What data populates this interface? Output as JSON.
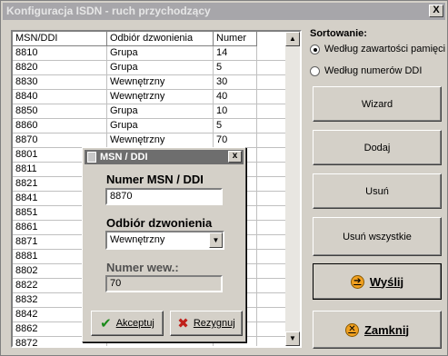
{
  "window": {
    "title": "Konfiguracja ISDN - ruch przychodzący",
    "close_label": "X"
  },
  "list": {
    "columns": [
      "MSN/DDI",
      "Odbiór dzwonienia",
      "Numer"
    ],
    "rows": [
      [
        "8810",
        "Grupa",
        "14"
      ],
      [
        "8820",
        "Grupa",
        "5"
      ],
      [
        "8830",
        "Wewnętrzny",
        "30"
      ],
      [
        "8840",
        "Wewnętrzny",
        "40"
      ],
      [
        "8850",
        "Grupa",
        "10"
      ],
      [
        "8860",
        "Grupa",
        "5"
      ],
      [
        "8870",
        "Wewnętrzny",
        "70"
      ],
      [
        "8801",
        "",
        ""
      ],
      [
        "8811",
        "",
        ""
      ],
      [
        "8821",
        "",
        ""
      ],
      [
        "8841",
        "",
        ""
      ],
      [
        "8851",
        "",
        ""
      ],
      [
        "8861",
        "",
        ""
      ],
      [
        "8871",
        "",
        ""
      ],
      [
        "8881",
        "",
        ""
      ],
      [
        "8802",
        "",
        ""
      ],
      [
        "8822",
        "",
        ""
      ],
      [
        "8832",
        "",
        ""
      ],
      [
        "8842",
        "",
        ""
      ],
      [
        "8862",
        "",
        ""
      ],
      [
        "8872",
        "",
        ""
      ]
    ]
  },
  "sorting": {
    "title": "Sortowanie:",
    "options": [
      "Według zawartości pamięci",
      "Według numerów DDI"
    ],
    "selected_index": 0
  },
  "buttons": {
    "wizard": "Wizard",
    "add": "Dodaj",
    "remove": "Usuń",
    "remove_all": "Usuń wszystkie",
    "send": "Wyślij",
    "close": "Zamknij"
  },
  "dialog": {
    "title": "MSN / DDI",
    "close_label": "x",
    "msn_label": "Numer  MSN / DDI",
    "msn_value": "8870",
    "ring_label": "Odbiór dzwonienia",
    "ring_value": "Wewnętrzny",
    "ext_label": "Numer wew.:",
    "ext_value": "70",
    "accept": "Akceptuj",
    "cancel": "Rezygnuj"
  }
}
